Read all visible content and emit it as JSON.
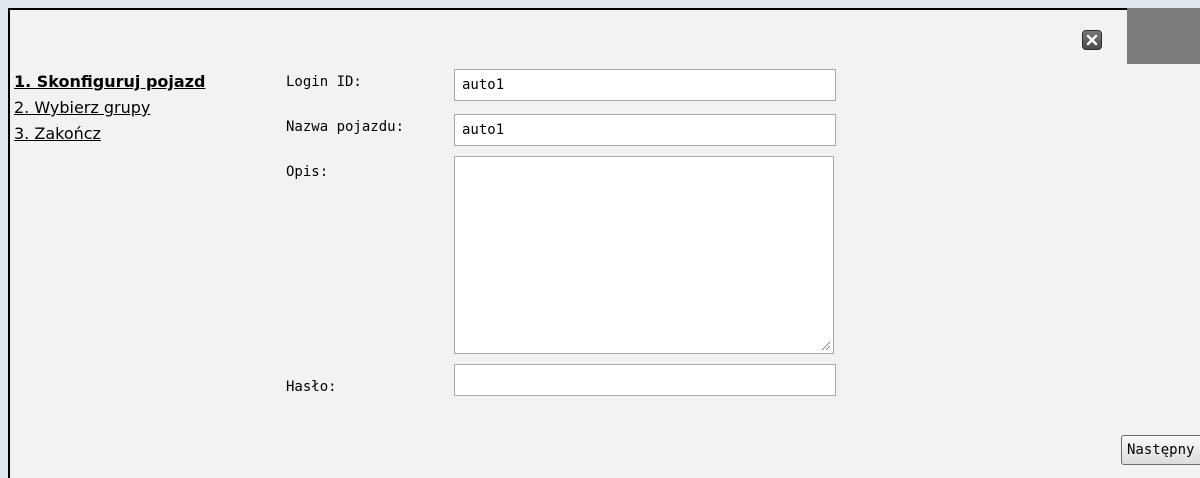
{
  "wizard": {
    "steps": [
      {
        "label": "1. Skonfiguruj pojazd",
        "active": true
      },
      {
        "label": "2. Wybierz grupy",
        "active": false
      },
      {
        "label": "3. Zakończ",
        "active": false
      }
    ]
  },
  "form": {
    "login_id": {
      "label": "Login ID:",
      "value": "auto1"
    },
    "vehicle_name": {
      "label": "Nazwa pojazdu:",
      "value": "auto1"
    },
    "description": {
      "label": "Opis:",
      "value": ""
    },
    "password": {
      "label": "Hasło:",
      "value": ""
    }
  },
  "buttons": {
    "next_label": "Następny"
  },
  "icons": {
    "close": "close-icon"
  }
}
